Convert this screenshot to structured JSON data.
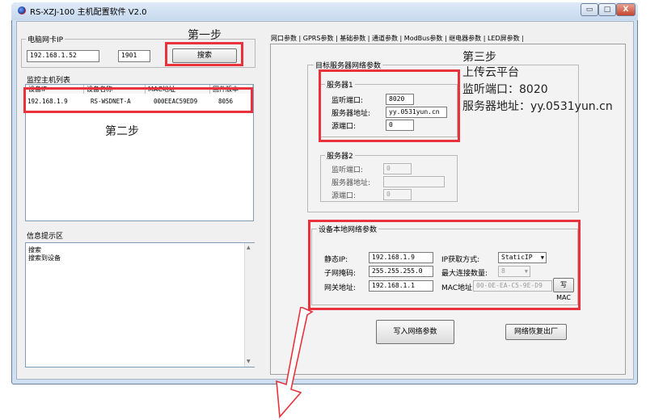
{
  "window": {
    "title": "RS-XZJ-100 主机配置软件 V2.0",
    "buttons": {
      "minimize": "▭",
      "maximize": "□",
      "close": "X"
    }
  },
  "left": {
    "nic_group_label": "电脑网卡IP",
    "nic_ip": "192.168.1.52",
    "nic_port": "1901",
    "search_button": "搜索",
    "monitor_list_label": "监控主机列表",
    "columns": [
      "设备IP",
      "设备名称",
      "MAC地址",
      "固件版本"
    ],
    "rows": [
      [
        "192.168.1.9",
        "RS-WSDNET-A",
        "000EEAC59ED9",
        "8056"
      ]
    ],
    "info_label": "信息提示区",
    "info_lines": [
      "搜索",
      "搜索到设备"
    ]
  },
  "tabs": [
    "网口参数",
    "GPRS参数",
    "基础参数",
    "通道参数",
    "ModBus参数",
    "继电器参数",
    "LED屏参数"
  ],
  "target_server": {
    "group_label": "目标服务器网络参数",
    "server1": {
      "label": "服务器1",
      "listen_port_label": "监听端口:",
      "listen_port": "8020",
      "address_label": "服务器地址:",
      "address": "yy.0531yun.cn",
      "source_port_label": "源端口:",
      "source_port": "0"
    },
    "server2": {
      "label": "服务器2",
      "listen_port_label": "监听端口:",
      "listen_port": "0",
      "address_label": "服务器地址:",
      "address": "",
      "source_port_label": "源端口:",
      "source_port": "0"
    }
  },
  "local_net": {
    "group_label": "设备本地网络参数",
    "static_ip_label": "静态IP:",
    "static_ip": "192.168.1.9",
    "ip_mode_label": "IP获取方式:",
    "ip_mode": "StaticIP",
    "subnet_label": "子网掩码:",
    "subnet": "255.255.255.0",
    "max_conn_label": "最大连接数量:",
    "max_conn": "8",
    "gateway_label": "网关地址:",
    "gateway": "192.168.1.1",
    "mac_label": "MAC地址:",
    "mac": "00-0E-EA-C5-9E-D9",
    "write_mac_button": "写MAC"
  },
  "bottom_buttons": {
    "write": "写入网络参数",
    "restore": "网络恢复出厂"
  },
  "annotations": {
    "step1": "第一步",
    "step2": "第二步",
    "step3": "第三步",
    "step3_l1": "上传云平台",
    "step3_l2": "监听端口：8020",
    "step3_l3": "服务器地址：yy.0531yun.cn"
  },
  "colors": {
    "highlight": "#e8333d",
    "window_frame": "#cfe0f2"
  }
}
